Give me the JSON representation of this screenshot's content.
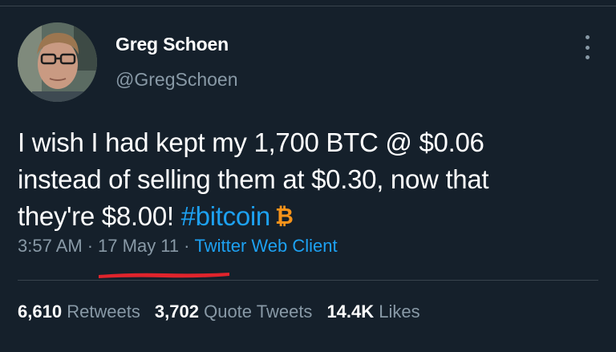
{
  "author": {
    "display_name": "Greg Schoen",
    "handle": "@GregSchoen"
  },
  "tweet": {
    "line1": "I wish I had kept my 1,700 BTC @ $0.06",
    "line2": "instead of selling them at $0.30, now that",
    "line3_prefix": "they're $8.00! ",
    "hashtag": "#bitcoin",
    "bitcoin_glyph": "₿"
  },
  "meta": {
    "time": "3:57 AM",
    "separator": "·",
    "date": "17 May 11",
    "client": "Twitter Web Client"
  },
  "stats": {
    "retweets_count": "6,610",
    "retweets_label": "Retweets",
    "quotes_count": "3,702",
    "quotes_label": "Quote Tweets",
    "likes_count": "14.4K",
    "likes_label": "Likes"
  },
  "colors": {
    "background": "#15202b",
    "link": "#1da1f2",
    "muted": "#8899a6",
    "bitcoin": "#f7931a",
    "annotation_underline": "#e0242c"
  },
  "icons": {
    "more": "more-options-icon",
    "bitcoin": "bitcoin-icon"
  }
}
